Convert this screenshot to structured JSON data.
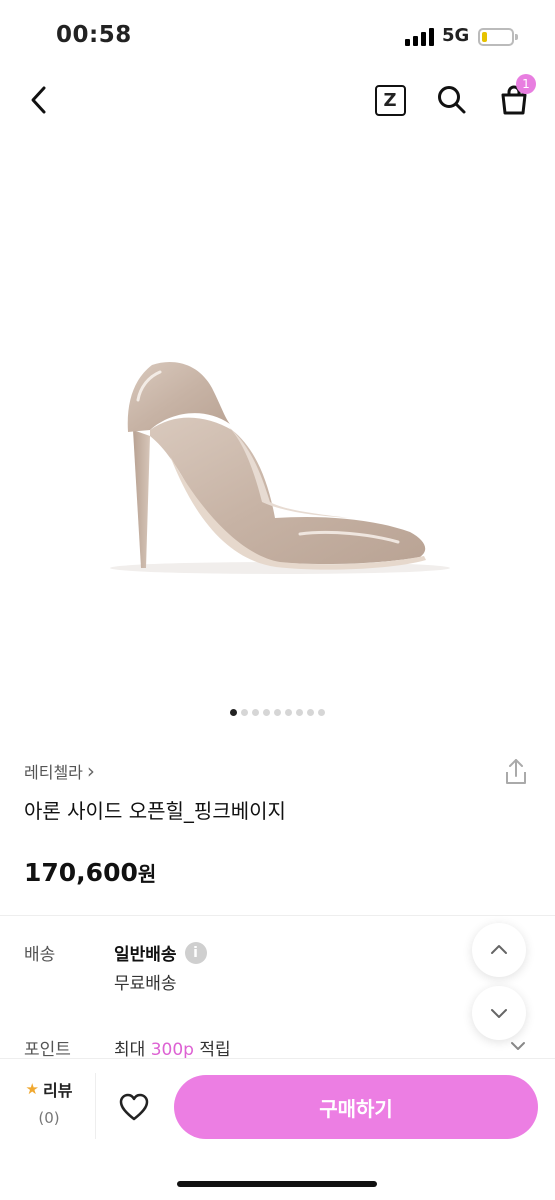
{
  "status_bar": {
    "time": "00:58",
    "network": "5G"
  },
  "nav": {
    "icons": [
      "back-chevron-icon",
      "zigzag-z-icon",
      "search-icon",
      "shopping-bag-icon"
    ],
    "z_label": "Z",
    "cart_badge": "1"
  },
  "product": {
    "image_pager": {
      "total": 9,
      "active": 1
    },
    "brand": "레티첼라",
    "brand_arrow": "›",
    "name": "아론 사이드 오픈힐_핑크베이지",
    "price": "170,600",
    "price_unit": "원"
  },
  "info": {
    "shipping_label": "배송",
    "shipping_type": "일반배송",
    "info_icon": "i",
    "shipping_fee": "무료배송",
    "point_label": "포인트",
    "point_prefix": "최대",
    "point_amount": "300p",
    "point_suffix": "적립"
  },
  "bottom_bar": {
    "review_label": "리뷰",
    "review_count": "(0)",
    "buy_label": "구매하기"
  },
  "colors": {
    "accent": "#ec7ee3",
    "point": "#dd62d3",
    "star": "#f0a830"
  }
}
